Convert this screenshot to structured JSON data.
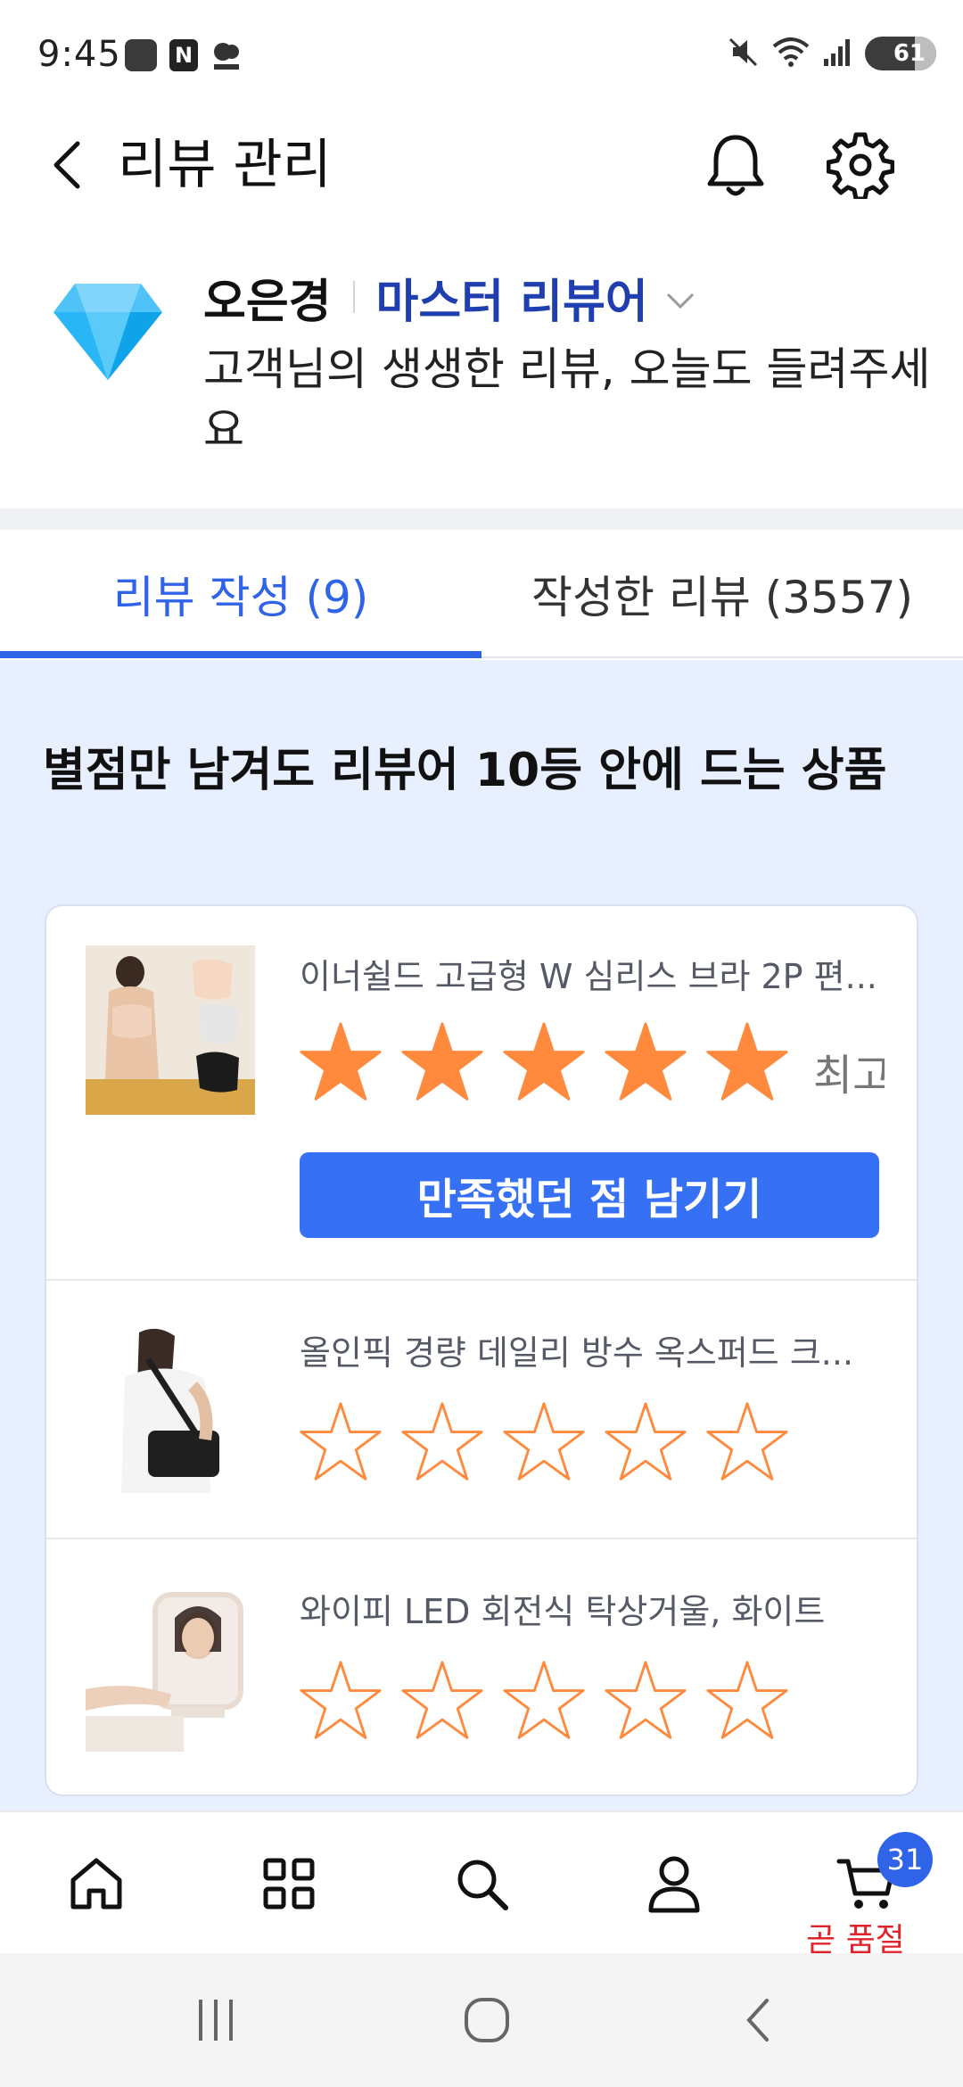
{
  "status_bar": {
    "time": "9:45",
    "app_icons": [
      "samsung-card-lounge-icon",
      "naver-icon",
      "won-icon"
    ],
    "n_label": "N",
    "battery": "61"
  },
  "header": {
    "title": "리뷰 관리"
  },
  "profile": {
    "name": "오은경",
    "grade": "마스터 리뷰어",
    "message": "고객님의 생생한 리뷰, 오늘도 들려주세요"
  },
  "tabs": [
    {
      "label": "리뷰 작성 (9)",
      "active": true
    },
    {
      "label": "작성한 리뷰 (3557)",
      "active": false
    }
  ],
  "section": {
    "title": "별점만 남겨도 리뷰어 10등 안에 드는 상품"
  },
  "products": [
    {
      "name": "이너쉴드 고급형 W 심리스 브라 2P 편...",
      "rating": 5,
      "rating_label": "최고",
      "cta": "만족했던 점 남기기"
    },
    {
      "name": "올인픽 경량 데일리 방수 옥스퍼드 크...",
      "rating": 0
    },
    {
      "name": "와이피 LED 회전식 탁상거울, 화이트",
      "rating": 0
    }
  ],
  "bottom_nav": {
    "items": [
      "home-icon",
      "category-grid-icon",
      "search-icon",
      "my-page-icon",
      "cart-icon"
    ],
    "cart_count": "31",
    "cart_note": "곧 품절"
  },
  "colors": {
    "accent": "#2f64e8",
    "grade": "#1f3fb0",
    "star": "#ff8a3d",
    "content_bg": "#e8efff",
    "alert": "#e0242c"
  }
}
